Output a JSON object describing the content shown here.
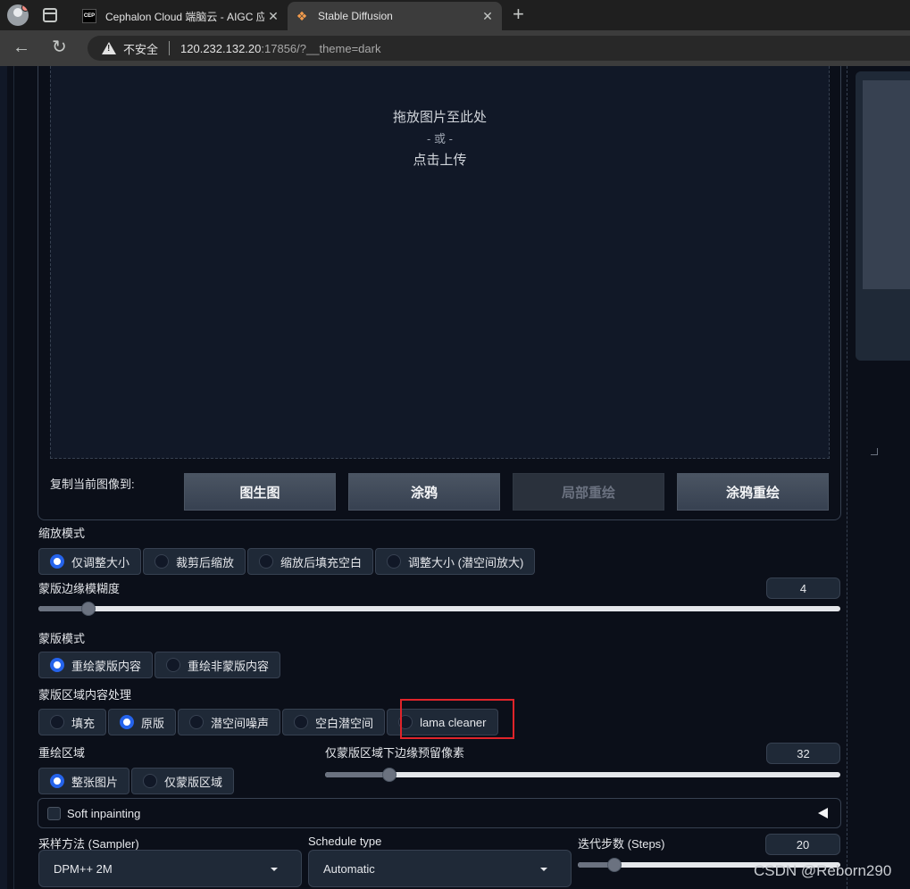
{
  "browser": {
    "tabs": [
      {
        "favicon": "CEP",
        "title": "Cephalon Cloud 端脑云 - AIGC 应"
      },
      {
        "favicon": "❖",
        "title": "Stable Diffusion"
      }
    ],
    "insecure_label": "不安全",
    "url_host": "120.232.132.20",
    "url_rest": ":17856/?__theme=dark"
  },
  "dropzone": {
    "line1": "拖放图片至此处",
    "line2": "- 或 -",
    "line3": "点击上传"
  },
  "copy": {
    "label": "复制当前图像到:",
    "buttons": [
      "图生图",
      "涂鸦",
      "局部重绘",
      "涂鸦重绘"
    ]
  },
  "resize_mode": {
    "label": "缩放模式",
    "options": [
      "仅调整大小",
      "裁剪后缩放",
      "缩放后填充空白",
      "调整大小 (潜空间放大)"
    ],
    "selected": 0
  },
  "mask_blur": {
    "label": "蒙版边缘模糊度",
    "value": "4",
    "fraction": 0.0625
  },
  "mask_mode": {
    "label": "蒙版模式",
    "options": [
      "重绘蒙版内容",
      "重绘非蒙版内容"
    ],
    "selected": 0
  },
  "masked_content": {
    "label": "蒙版区域内容处理",
    "options": [
      "填充",
      "原版",
      "潜空间噪声",
      "空白潜空间",
      "lama cleaner"
    ],
    "selected": 1
  },
  "inpaint_area": {
    "label": "重绘区域",
    "options": [
      "整张图片",
      "仅蒙版区域"
    ],
    "selected": 0
  },
  "padding": {
    "label": "仅蒙版区域下边缘预留像素",
    "value": "32",
    "fraction": 0.125
  },
  "soft_inpainting": {
    "label": "Soft inpainting"
  },
  "sampler": {
    "label": "采样方法 (Sampler)",
    "value": "DPM++ 2M"
  },
  "schedule": {
    "label": "Schedule type",
    "value": "Automatic"
  },
  "steps": {
    "label": "迭代步数 (Steps)",
    "value": "20",
    "fraction": 0.141
  },
  "watermark": "CSDN @Reborn290"
}
